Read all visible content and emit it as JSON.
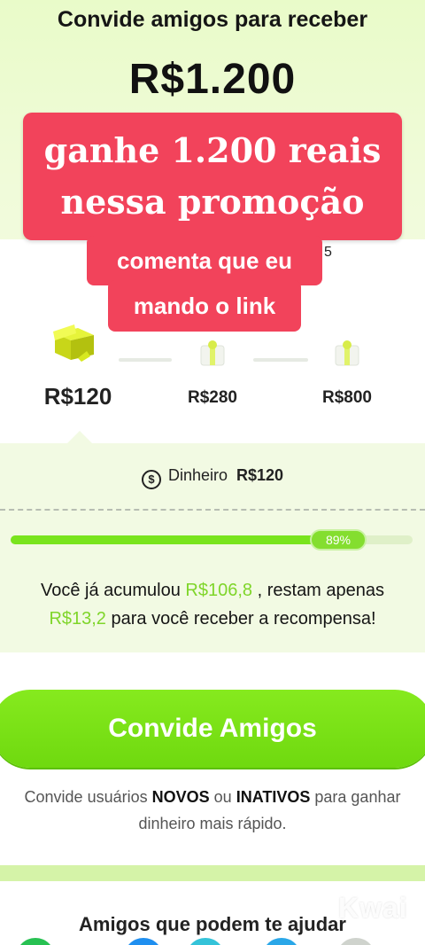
{
  "header": {
    "title": "Convide amigos para receber",
    "amount": "R$1.200"
  },
  "overlay": {
    "promo_line1": "ganhe 1.200 reais",
    "promo_line2": "nessa promoção",
    "comment_line1": "comenta que eu",
    "comment_line2": "mando o link",
    "partial_text": "5"
  },
  "steps": [
    {
      "label": "R$120",
      "active": true
    },
    {
      "label": "R$280",
      "active": false
    },
    {
      "label": "R$800",
      "active": false
    }
  ],
  "reward": {
    "icon": "$",
    "type_label": "Dinheiro",
    "value": "R$120"
  },
  "progress": {
    "percent": 89,
    "percent_label": "89%"
  },
  "accumulated": {
    "prefix": "Você já acumulou",
    "amount": "R$106,8",
    "middle": ", restam apenas",
    "remaining": "R$13,2",
    "suffix": "para você receber a recompensa!"
  },
  "cta": {
    "label": "Convide Amigos"
  },
  "hint": {
    "part1": "Convide usuários",
    "strong1": "NOVOS",
    "part2": "ou",
    "strong2": "INATIVOS",
    "part3": "para ganhar",
    "line2": "dinheiro mais rápido."
  },
  "friends_section": {
    "title": "Amigos que podem te ajudar"
  },
  "watermark": "Kwai",
  "colors": {
    "accent_green": "#79e41d",
    "promo_red": "#f2435b",
    "highlight_green": "#7fd52a"
  }
}
